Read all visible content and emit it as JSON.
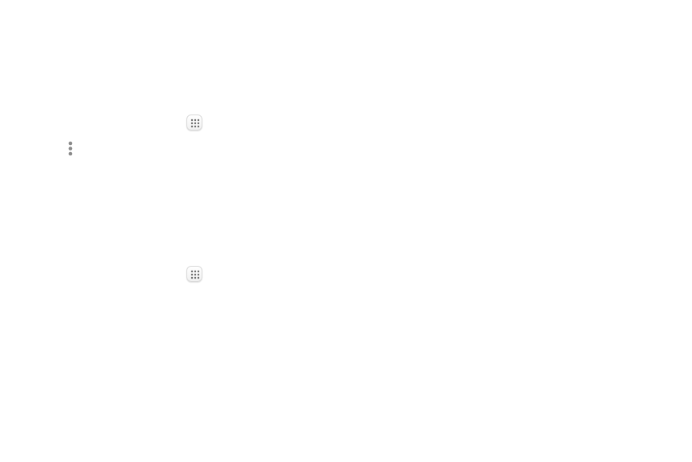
{
  "icons": [
    {
      "id": "apps-icon-1",
      "name": "apps-grid-icon"
    },
    {
      "id": "more-options",
      "name": "more-options-vertical-icon"
    },
    {
      "id": "apps-icon-2",
      "name": "apps-grid-icon"
    }
  ],
  "colors": {
    "background": "#ffffff",
    "icon_dot": "#6f6f6f",
    "menu_dot": "#8a8a8a",
    "icon_border": "#d9d9d9"
  }
}
